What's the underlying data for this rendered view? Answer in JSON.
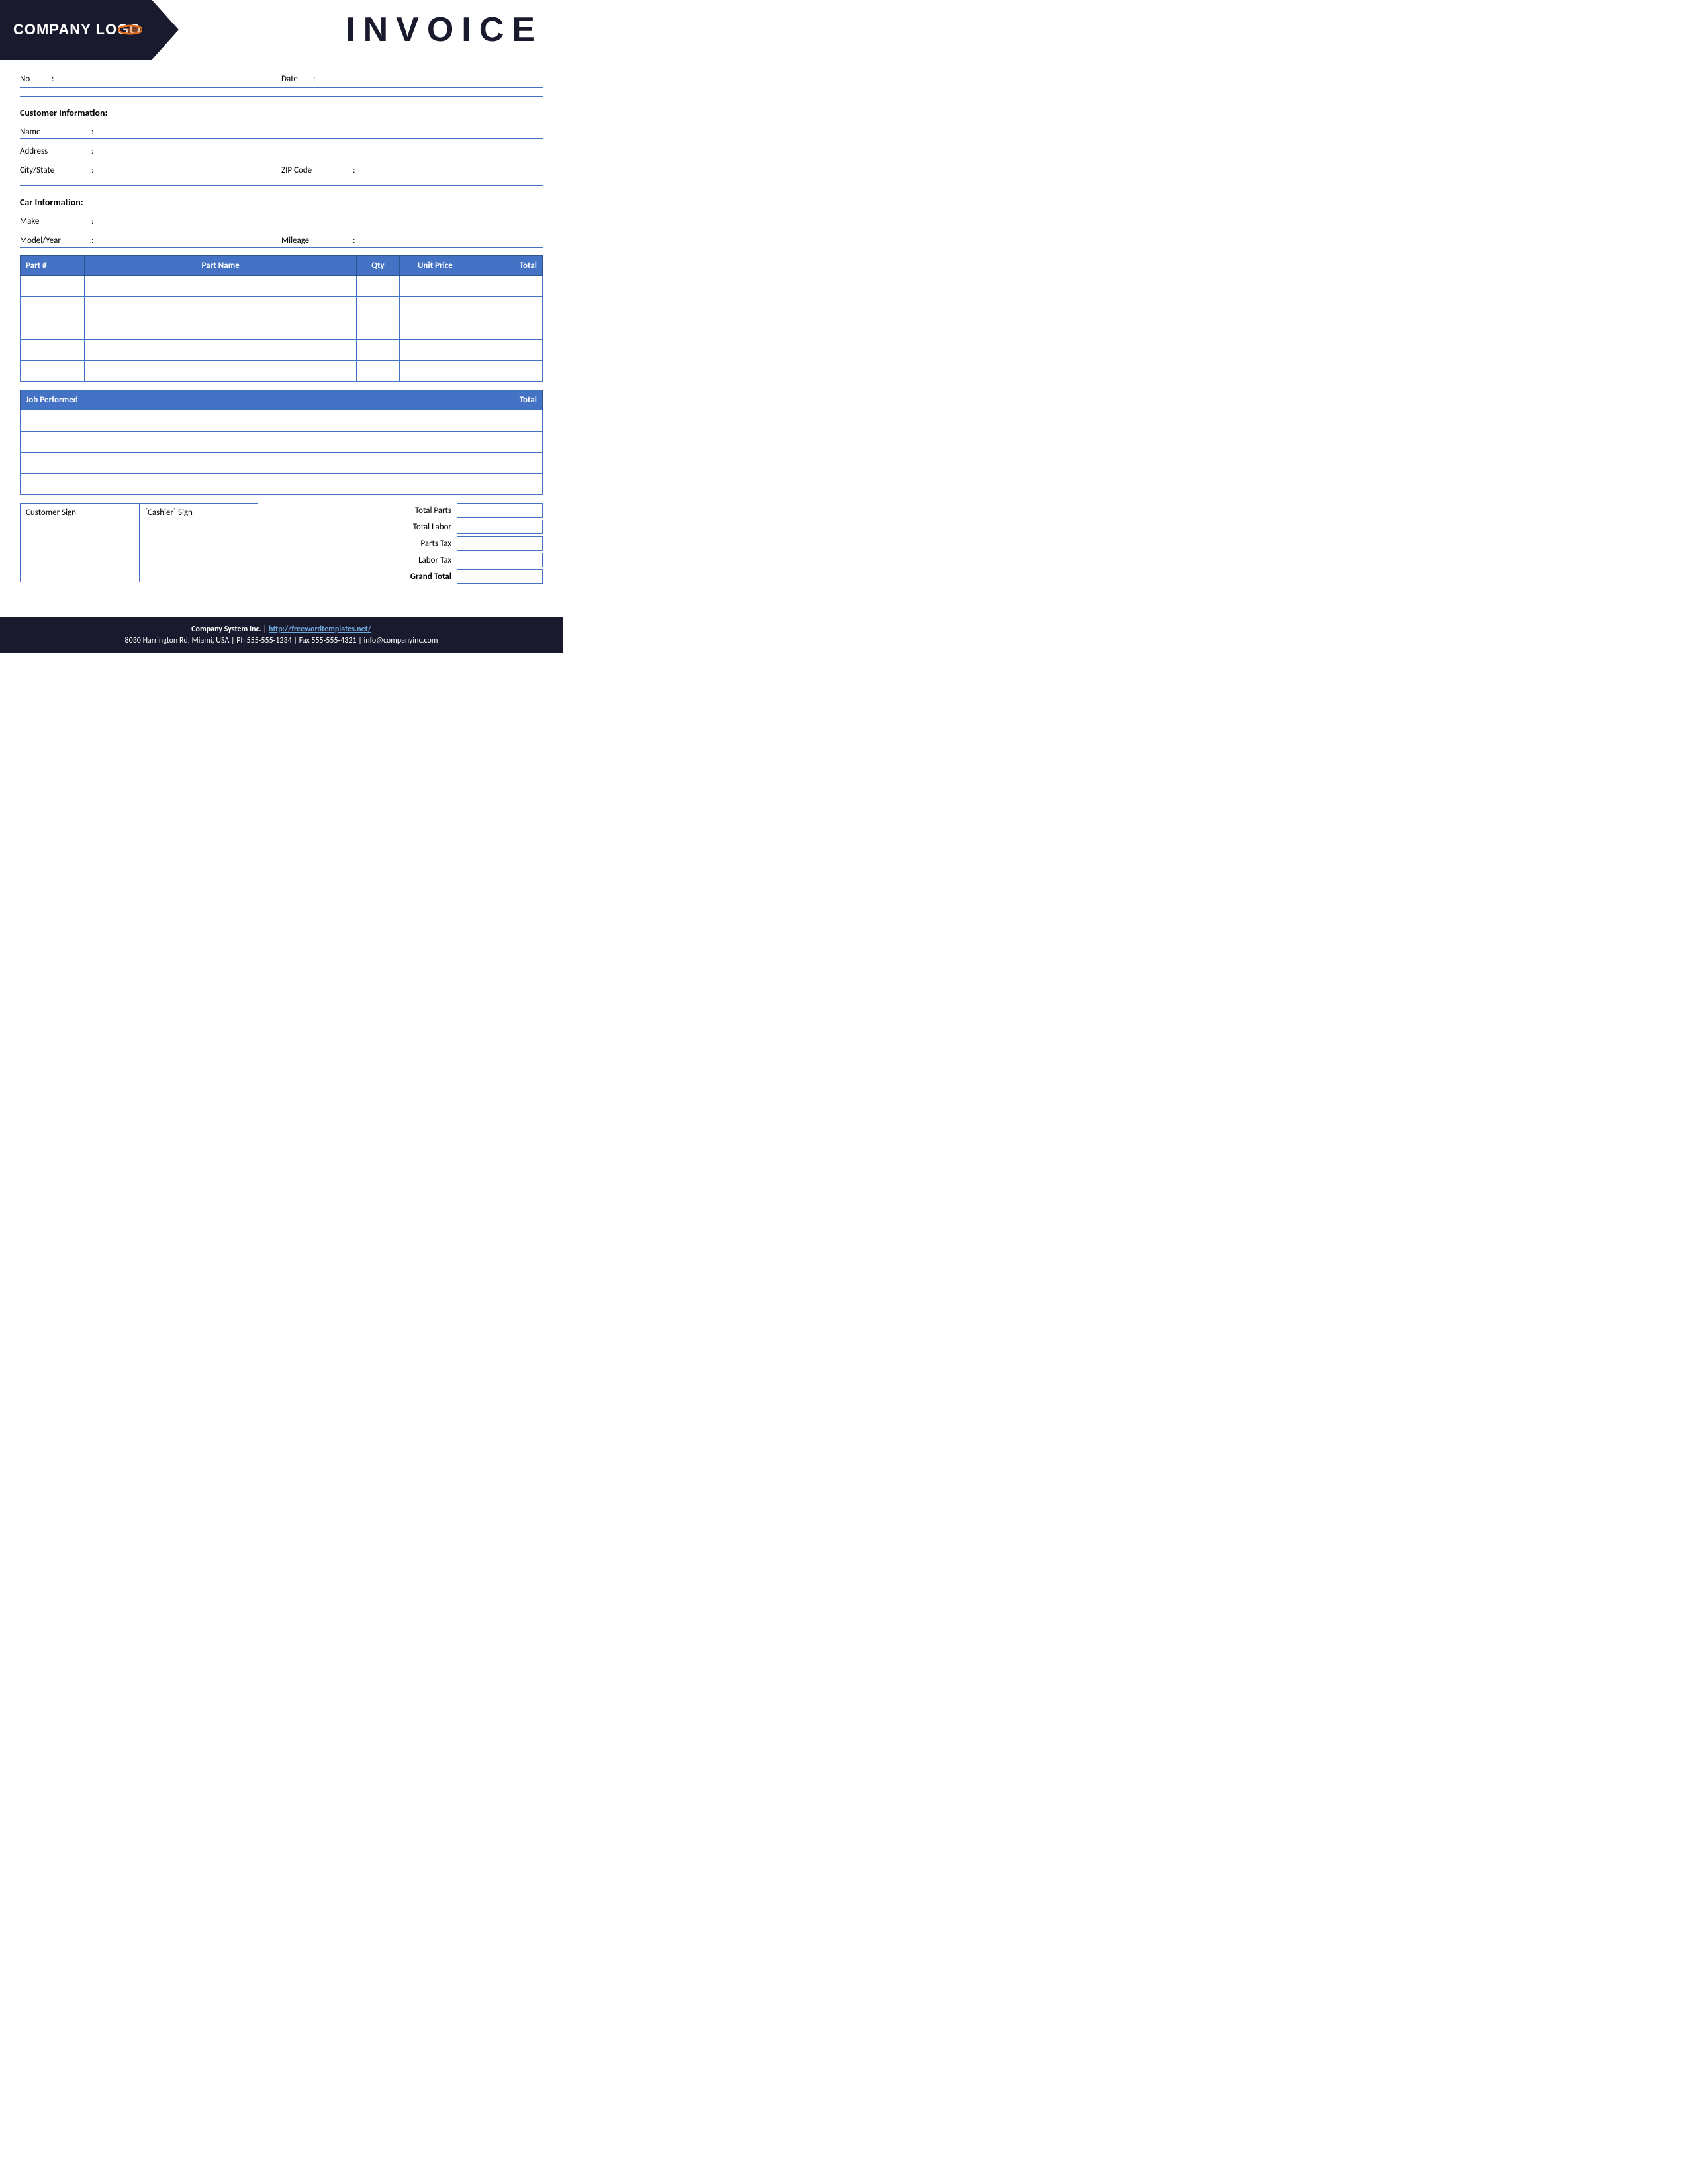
{
  "header": {
    "logo_text": "COMPANY LOGO",
    "invoice_title": "INVOICE"
  },
  "form": {
    "no_label": "No",
    "date_label": "Date",
    "colon": ":"
  },
  "customer": {
    "section_title": "Customer Information:",
    "name_label": "Name",
    "address_label": "Address",
    "city_state_label": "City/State",
    "zip_label": "ZIP Code"
  },
  "car": {
    "section_title": "Car Information:",
    "make_label": "Make",
    "model_label": "Model/Year",
    "mileage_label": "Mileage"
  },
  "parts_table": {
    "col_part": "Part #",
    "col_name": "Part Name",
    "col_qty": "Qty",
    "col_unit": "Unit Price",
    "col_total": "Total",
    "rows": 5
  },
  "job_table": {
    "col_job": "Job Performed",
    "col_total": "Total",
    "rows": 4
  },
  "signatures": {
    "customer_sign": "Customer Sign",
    "cashier_sign": "[Cashier] Sign"
  },
  "totals": {
    "total_parts": "Total Parts",
    "total_labor": "Total Labor",
    "parts_tax": "Parts Tax",
    "labor_tax": "Labor Tax",
    "grand_total": "Grand Total"
  },
  "footer": {
    "line1": "Company System Inc. | http://freewordtemplates.net/",
    "line2": "8030 Harrington Rd, Miami, USA | Ph 555-555-1234 | Fax 555-555-4321 | info@companyinc.com",
    "link": "http://freewordtemplates.net/"
  }
}
